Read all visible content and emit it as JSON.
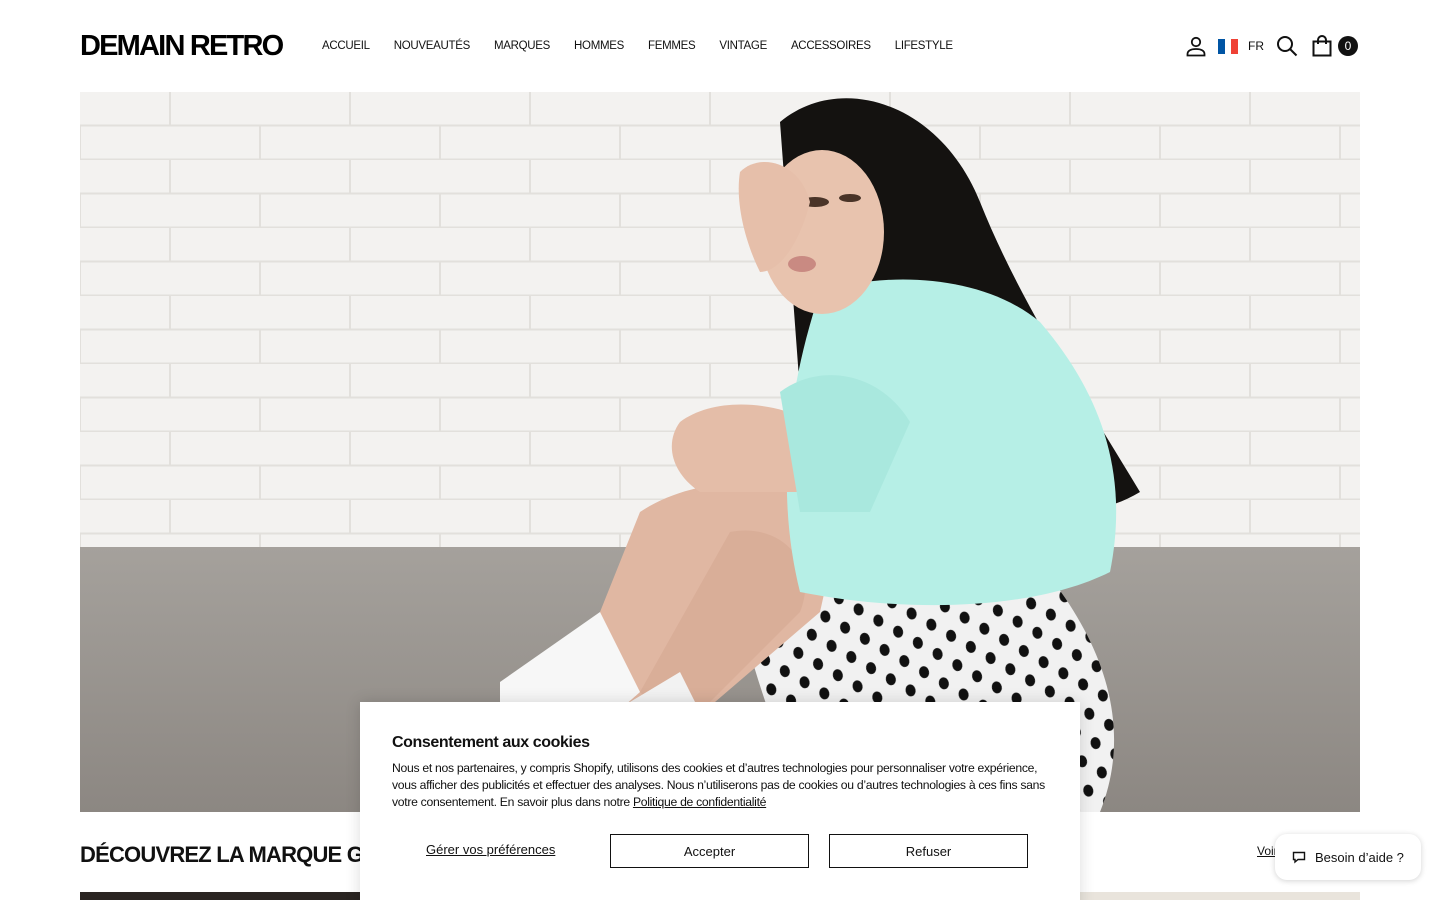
{
  "header": {
    "logo": "DEMAIN RETRO",
    "nav": [
      "ACCUEIL",
      "NOUVEAUTÉS",
      "MARQUES",
      "HOMMES",
      "FEMMES",
      "VINTAGE",
      "ACCESSOIRES",
      "LIFESTYLE"
    ],
    "language": "FR",
    "cart_count": "0",
    "icons": [
      "user-icon",
      "france-flag-icon",
      "search-icon",
      "shopping-bag-icon"
    ]
  },
  "hero": {
    "image": "woman-seated-against-white-brick-wall"
  },
  "section": {
    "title": "DÉCOUVREZ LA MARQUE G",
    "see_all": "Voir"
  },
  "cookie": {
    "title": "Consentement aux cookies",
    "text": "Nous et nos partenaires, y compris Shopify, utilisons des cookies et d’autres technologies pour personnaliser votre expérience, vous afficher des publicités et effectuer des analyses. Nous n’utiliserons pas de cookies ou d’autres technologies à ces fins sans votre consentement. En savoir plus dans notre ",
    "policy_link": "Politique de confidentialité",
    "manage": "Gérer vos préférences",
    "accept": "Accepter",
    "refuse": "Refuser"
  },
  "help": {
    "label": "Besoin d’aide ?",
    "icon": "chat-bubble-icon"
  },
  "colors": {
    "text": "#111111",
    "flag_blue": "#0055a4",
    "flag_white": "#ffffff",
    "flag_red": "#ef4135"
  }
}
